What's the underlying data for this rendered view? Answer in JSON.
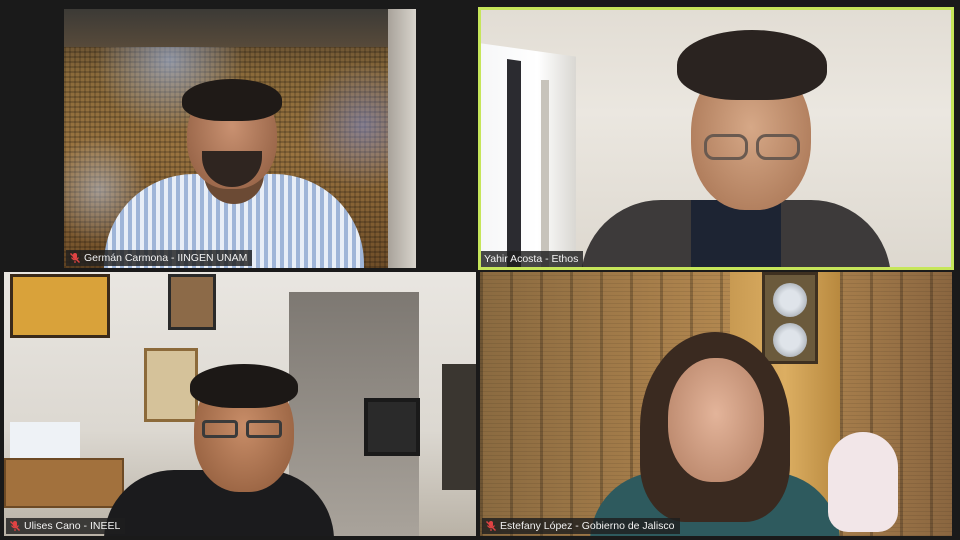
{
  "app": {
    "active_speaker_color": "#c6e65a",
    "mute_icon_color": "#e04343"
  },
  "participants": [
    {
      "name": "Germán Carmona - IINGEN UNAM",
      "muted": true,
      "icon": "mic-muted-icon",
      "active_speaker": false
    },
    {
      "name": "Yahir Acosta - Ethos",
      "muted": false,
      "icon": "",
      "active_speaker": true
    },
    {
      "name": "Ulises Cano - INEEL",
      "muted": true,
      "icon": "mic-muted-icon",
      "active_speaker": false
    },
    {
      "name": "Estefany López - Gobierno de Jalisco",
      "muted": true,
      "icon": "mic-muted-icon",
      "active_speaker": false
    }
  ]
}
